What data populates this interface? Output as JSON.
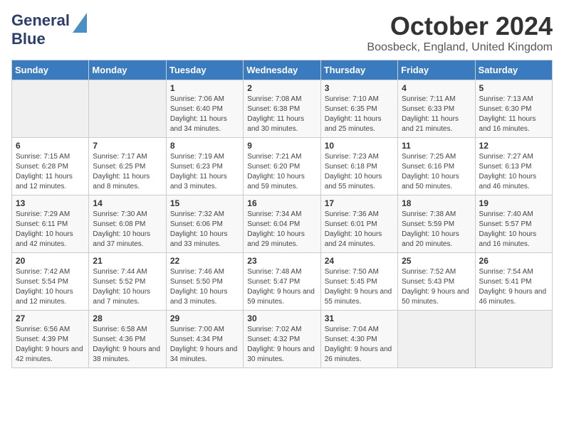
{
  "header": {
    "logo_line1": "General",
    "logo_line2": "Blue",
    "month_title": "October 2024",
    "location": "Boosbeck, England, United Kingdom"
  },
  "days_of_week": [
    "Sunday",
    "Monday",
    "Tuesday",
    "Wednesday",
    "Thursday",
    "Friday",
    "Saturday"
  ],
  "weeks": [
    [
      {
        "day": "",
        "sunrise": "",
        "sunset": "",
        "daylight": ""
      },
      {
        "day": "",
        "sunrise": "",
        "sunset": "",
        "daylight": ""
      },
      {
        "day": "1",
        "sunrise": "Sunrise: 7:06 AM",
        "sunset": "Sunset: 6:40 PM",
        "daylight": "Daylight: 11 hours and 34 minutes."
      },
      {
        "day": "2",
        "sunrise": "Sunrise: 7:08 AM",
        "sunset": "Sunset: 6:38 PM",
        "daylight": "Daylight: 11 hours and 30 minutes."
      },
      {
        "day": "3",
        "sunrise": "Sunrise: 7:10 AM",
        "sunset": "Sunset: 6:35 PM",
        "daylight": "Daylight: 11 hours and 25 minutes."
      },
      {
        "day": "4",
        "sunrise": "Sunrise: 7:11 AM",
        "sunset": "Sunset: 6:33 PM",
        "daylight": "Daylight: 11 hours and 21 minutes."
      },
      {
        "day": "5",
        "sunrise": "Sunrise: 7:13 AM",
        "sunset": "Sunset: 6:30 PM",
        "daylight": "Daylight: 11 hours and 16 minutes."
      }
    ],
    [
      {
        "day": "6",
        "sunrise": "Sunrise: 7:15 AM",
        "sunset": "Sunset: 6:28 PM",
        "daylight": "Daylight: 11 hours and 12 minutes."
      },
      {
        "day": "7",
        "sunrise": "Sunrise: 7:17 AM",
        "sunset": "Sunset: 6:25 PM",
        "daylight": "Daylight: 11 hours and 8 minutes."
      },
      {
        "day": "8",
        "sunrise": "Sunrise: 7:19 AM",
        "sunset": "Sunset: 6:23 PM",
        "daylight": "Daylight: 11 hours and 3 minutes."
      },
      {
        "day": "9",
        "sunrise": "Sunrise: 7:21 AM",
        "sunset": "Sunset: 6:20 PM",
        "daylight": "Daylight: 10 hours and 59 minutes."
      },
      {
        "day": "10",
        "sunrise": "Sunrise: 7:23 AM",
        "sunset": "Sunset: 6:18 PM",
        "daylight": "Daylight: 10 hours and 55 minutes."
      },
      {
        "day": "11",
        "sunrise": "Sunrise: 7:25 AM",
        "sunset": "Sunset: 6:16 PM",
        "daylight": "Daylight: 10 hours and 50 minutes."
      },
      {
        "day": "12",
        "sunrise": "Sunrise: 7:27 AM",
        "sunset": "Sunset: 6:13 PM",
        "daylight": "Daylight: 10 hours and 46 minutes."
      }
    ],
    [
      {
        "day": "13",
        "sunrise": "Sunrise: 7:29 AM",
        "sunset": "Sunset: 6:11 PM",
        "daylight": "Daylight: 10 hours and 42 minutes."
      },
      {
        "day": "14",
        "sunrise": "Sunrise: 7:30 AM",
        "sunset": "Sunset: 6:08 PM",
        "daylight": "Daylight: 10 hours and 37 minutes."
      },
      {
        "day": "15",
        "sunrise": "Sunrise: 7:32 AM",
        "sunset": "Sunset: 6:06 PM",
        "daylight": "Daylight: 10 hours and 33 minutes."
      },
      {
        "day": "16",
        "sunrise": "Sunrise: 7:34 AM",
        "sunset": "Sunset: 6:04 PM",
        "daylight": "Daylight: 10 hours and 29 minutes."
      },
      {
        "day": "17",
        "sunrise": "Sunrise: 7:36 AM",
        "sunset": "Sunset: 6:01 PM",
        "daylight": "Daylight: 10 hours and 24 minutes."
      },
      {
        "day": "18",
        "sunrise": "Sunrise: 7:38 AM",
        "sunset": "Sunset: 5:59 PM",
        "daylight": "Daylight: 10 hours and 20 minutes."
      },
      {
        "day": "19",
        "sunrise": "Sunrise: 7:40 AM",
        "sunset": "Sunset: 5:57 PM",
        "daylight": "Daylight: 10 hours and 16 minutes."
      }
    ],
    [
      {
        "day": "20",
        "sunrise": "Sunrise: 7:42 AM",
        "sunset": "Sunset: 5:54 PM",
        "daylight": "Daylight: 10 hours and 12 minutes."
      },
      {
        "day": "21",
        "sunrise": "Sunrise: 7:44 AM",
        "sunset": "Sunset: 5:52 PM",
        "daylight": "Daylight: 10 hours and 7 minutes."
      },
      {
        "day": "22",
        "sunrise": "Sunrise: 7:46 AM",
        "sunset": "Sunset: 5:50 PM",
        "daylight": "Daylight: 10 hours and 3 minutes."
      },
      {
        "day": "23",
        "sunrise": "Sunrise: 7:48 AM",
        "sunset": "Sunset: 5:47 PM",
        "daylight": "Daylight: 9 hours and 59 minutes."
      },
      {
        "day": "24",
        "sunrise": "Sunrise: 7:50 AM",
        "sunset": "Sunset: 5:45 PM",
        "daylight": "Daylight: 9 hours and 55 minutes."
      },
      {
        "day": "25",
        "sunrise": "Sunrise: 7:52 AM",
        "sunset": "Sunset: 5:43 PM",
        "daylight": "Daylight: 9 hours and 50 minutes."
      },
      {
        "day": "26",
        "sunrise": "Sunrise: 7:54 AM",
        "sunset": "Sunset: 5:41 PM",
        "daylight": "Daylight: 9 hours and 46 minutes."
      }
    ],
    [
      {
        "day": "27",
        "sunrise": "Sunrise: 6:56 AM",
        "sunset": "Sunset: 4:39 PM",
        "daylight": "Daylight: 9 hours and 42 minutes."
      },
      {
        "day": "28",
        "sunrise": "Sunrise: 6:58 AM",
        "sunset": "Sunset: 4:36 PM",
        "daylight": "Daylight: 9 hours and 38 minutes."
      },
      {
        "day": "29",
        "sunrise": "Sunrise: 7:00 AM",
        "sunset": "Sunset: 4:34 PM",
        "daylight": "Daylight: 9 hours and 34 minutes."
      },
      {
        "day": "30",
        "sunrise": "Sunrise: 7:02 AM",
        "sunset": "Sunset: 4:32 PM",
        "daylight": "Daylight: 9 hours and 30 minutes."
      },
      {
        "day": "31",
        "sunrise": "Sunrise: 7:04 AM",
        "sunset": "Sunset: 4:30 PM",
        "daylight": "Daylight: 9 hours and 26 minutes."
      },
      {
        "day": "",
        "sunrise": "",
        "sunset": "",
        "daylight": ""
      },
      {
        "day": "",
        "sunrise": "",
        "sunset": "",
        "daylight": ""
      }
    ]
  ]
}
